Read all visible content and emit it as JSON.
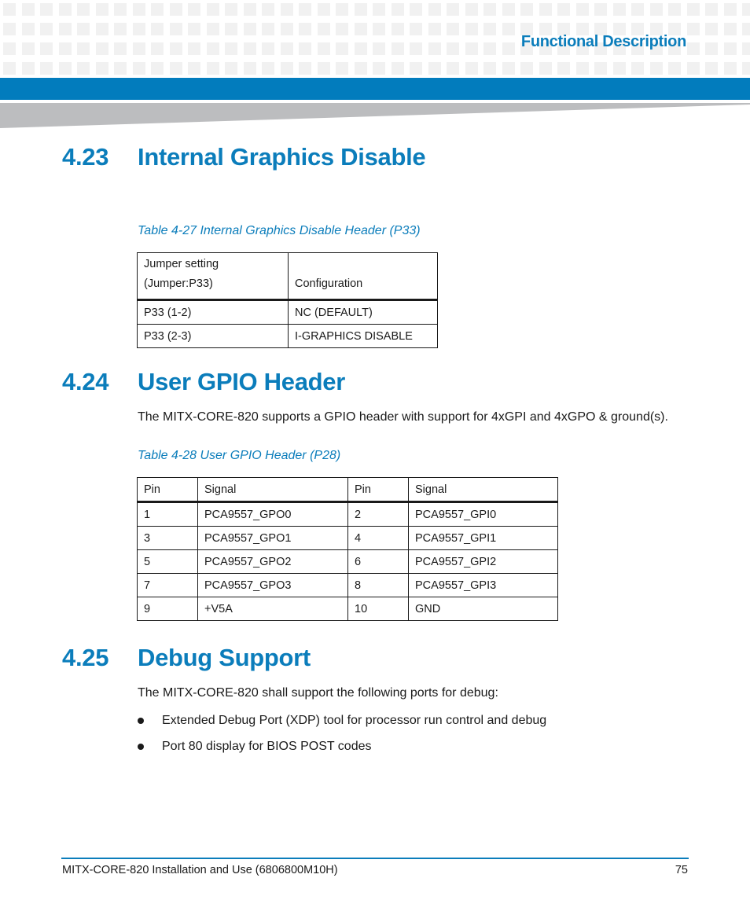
{
  "header": {
    "running_title": "Functional Description"
  },
  "sections": [
    {
      "number": "4.23",
      "title": "Internal Graphics Disable"
    },
    {
      "number": "4.24",
      "title": "User GPIO Header"
    },
    {
      "number": "4.25",
      "title": "Debug Support"
    }
  ],
  "table_4_27": {
    "caption": "Table 4-27 Internal Graphics Disable Header (P33)",
    "headers": [
      "Jumper setting",
      "(Jumper:P33)",
      "Configuration"
    ],
    "rows": [
      [
        "P33 (1-2)",
        "NC (DEFAULT)"
      ],
      [
        "P33 (2-3)",
        "I-GRAPHICS DISABLE"
      ]
    ]
  },
  "gpio": {
    "intro": "The MITX-CORE-820 supports a GPIO header with support for 4xGPI and 4xGPO & ground(s)."
  },
  "table_4_28": {
    "caption": "Table 4-28 User GPIO Header (P28)",
    "headers": [
      "Pin",
      "Signal",
      "Pin",
      "Signal"
    ],
    "rows": [
      [
        "1",
        "PCA9557_GPO0",
        "2",
        "PCA9557_GPI0"
      ],
      [
        "3",
        "PCA9557_GPO1",
        "4",
        "PCA9557_GPI1"
      ],
      [
        "5",
        "PCA9557_GPO2",
        "6",
        "PCA9557_GPI2"
      ],
      [
        "7",
        "PCA9557_GPO3",
        "8",
        "PCA9557_GPI3"
      ],
      [
        "9",
        "+V5A",
        "10",
        "GND"
      ]
    ]
  },
  "debug": {
    "intro": "The MITX-CORE-820 shall support the following ports for debug:",
    "bullets": [
      "Extended Debug Port (XDP) tool for processor run control and debug",
      "Port 80 display for BIOS POST codes"
    ]
  },
  "footer": {
    "doc_title": "MITX-CORE-820 Installation and Use (6806800M10H)",
    "page_number": "75"
  }
}
